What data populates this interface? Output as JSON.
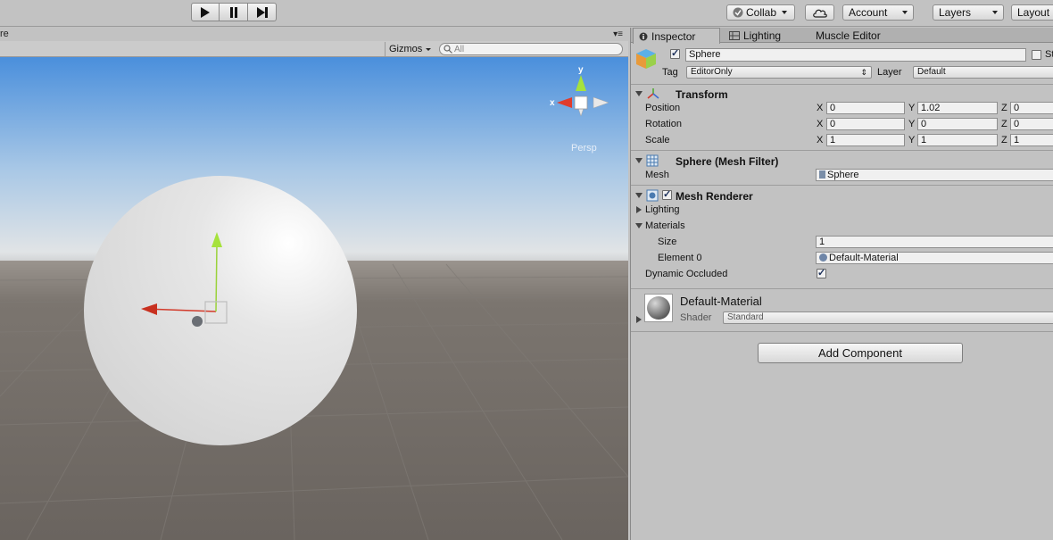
{
  "toolbar": {
    "collab_label": "Collab",
    "account_label": "Account",
    "layers_label": "Layers",
    "layout_label": "Layout"
  },
  "scene": {
    "tab_label_fragment": "re",
    "gizmos_label": "Gizmos",
    "search_placeholder": "All",
    "persp_label": "Persp",
    "axis_y_label": "y",
    "axis_x_label": "x"
  },
  "inspector": {
    "tabs": [
      {
        "label": "Inspector"
      },
      {
        "label": "Lighting"
      },
      {
        "label": "Muscle Editor"
      }
    ],
    "object": {
      "name": "Sphere",
      "static_fragment": "St",
      "tag_label": "Tag",
      "tag_value": "EditorOnly",
      "layer_label": "Layer",
      "layer_value": "Default"
    },
    "transform": {
      "title": "Transform",
      "x_label": "X",
      "y_label": "Y",
      "z_label": "Z",
      "position_label": "Position",
      "position": {
        "x": "0",
        "y": "1.02",
        "z": "0"
      },
      "rotation_label": "Rotation",
      "rotation": {
        "x": "0",
        "y": "0",
        "z": "0"
      },
      "scale_label": "Scale",
      "scale": {
        "x": "1",
        "y": "1",
        "z": "1"
      }
    },
    "mesh_filter": {
      "title": "Sphere (Mesh Filter)",
      "mesh_label": "Mesh",
      "mesh_value": "Sphere"
    },
    "mesh_renderer": {
      "title": "Mesh Renderer",
      "lighting_label": "Lighting",
      "materials_label": "Materials",
      "size_label": "Size",
      "size_value": "1",
      "element0_label": "Element 0",
      "element0_value": "Default-Material",
      "dynamic_occluded_label": "Dynamic Occluded"
    },
    "material": {
      "name": "Default-Material",
      "shader_label": "Shader",
      "shader_value": "Standard"
    },
    "add_component_label": "Add Component"
  },
  "colors": {
    "panel_bg": "#c2c2c2",
    "sky_top": "#4a8fdc",
    "ground": "#6e6862",
    "axis_x": "#e03c2c",
    "axis_y": "#a6e23c",
    "axis_z": "#3c6fe0"
  }
}
